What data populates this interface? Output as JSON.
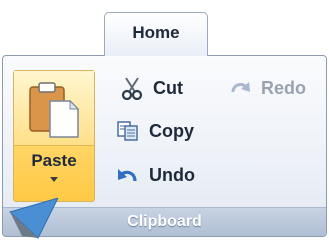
{
  "tab": {
    "label": "Home"
  },
  "group": {
    "label": "Clipboard"
  },
  "paste": {
    "label": "Paste"
  },
  "commands": {
    "cut": "Cut",
    "copy": "Copy",
    "undo": "Undo",
    "redo": "Redo"
  },
  "icons": {
    "paste": "clipboard-paste-icon",
    "cut": "scissors-icon",
    "copy": "copy-icon",
    "undo": "undo-icon",
    "redo": "redo-icon",
    "pointer": "callout-pointer-icon"
  },
  "colors": {
    "paste_highlight": "#ffd86e",
    "group_bar": "#b0bfd4",
    "text": "#1e2a3c",
    "disabled_text": "#9aa3b0",
    "pointer": "#4a8fd4"
  }
}
